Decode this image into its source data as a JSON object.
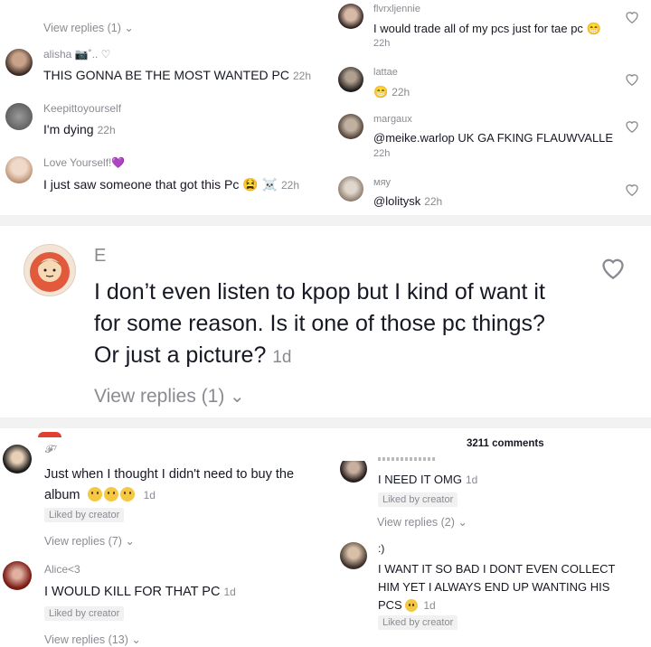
{
  "top_left": {
    "view_replies_1": "View replies (1)",
    "comments": [
      {
        "user": "alisha",
        "user_suffix": "📷˚.. ♡",
        "text": "THIS GONNA BE THE MOST WANTED PC",
        "time": "22h"
      },
      {
        "user": "Keepittoyourself",
        "text": "I'm dying",
        "time": "22h"
      },
      {
        "user": "Love Yourself!",
        "user_suffix": "💜",
        "text": "I just saw someone that got this Pc",
        "emoji_suffix": "😫 ☠️",
        "time": "22h"
      }
    ]
  },
  "top_right": {
    "comments": [
      {
        "user": "flvrxljennie",
        "text": "I would trade all of my pcs just for tae pc",
        "emoji_suffix": "😁",
        "time": "22h"
      },
      {
        "user": "lattae",
        "text": "😁",
        "time": "22h"
      },
      {
        "user": "margaux",
        "text": "@meike.warlop UK GA FKING FLAUWVALLE",
        "time": "22h"
      },
      {
        "user": "мяу",
        "text": "@lolitysk",
        "time": "22h"
      }
    ]
  },
  "middle": {
    "user": "E",
    "line1": "I don’t even listen to kpop but I kind of want it",
    "line2": "for some reason. Is it one of those pc things?",
    "line3": "Or just a picture?",
    "time": "1d",
    "view_replies": "View replies (1)"
  },
  "bottom_left": {
    "comments": [
      {
        "user": "𝓕⁷",
        "line1": "Just when I thought I didn't need to buy the",
        "line2": "album",
        "time": "1d",
        "liked": "Liked by creator",
        "view_replies": "View replies (7)"
      },
      {
        "user": "Alice<3",
        "text": "I WOULD KILL FOR THAT PC",
        "time": "1d",
        "liked": "Liked by creator",
        "view_replies": "View replies (13)"
      }
    ]
  },
  "bottom_right": {
    "header": "3211 comments",
    "comments": [
      {
        "text": "I NEED IT OMG",
        "time": "1d",
        "liked": "Liked by creator",
        "view_replies": "View replies (2)"
      },
      {
        "user": ":)",
        "line1": "I WANT IT SO BAD I DONT EVEN COLLECT",
        "line2": "HIM YET I ALWAYS END UP WANTING HIS",
        "line3": "PCS",
        "time": "1d",
        "liked": "Liked by creator"
      }
    ]
  },
  "colors": {
    "text": "#161823",
    "muted": "#8a8b91",
    "heart": "#8a8b91"
  }
}
